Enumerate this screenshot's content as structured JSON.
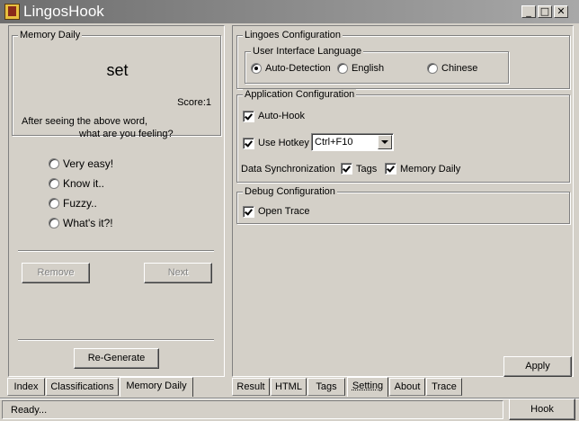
{
  "window": {
    "title": "LingosHook",
    "controls": {
      "minimize": "_",
      "maximize": "□",
      "close": "✕"
    }
  },
  "left": {
    "group_title": "Memory Daily",
    "word": "set",
    "score": "Score:1",
    "question_line1": "After seeing the above word,",
    "question_line2": "what are you feeling?",
    "options": [
      "Very easy!",
      "Know it..",
      "Fuzzy..",
      "What's it?!"
    ],
    "remove_label": "Remove",
    "next_label": "Next",
    "regenerate_label": "Re-Generate",
    "tabs": [
      "Index",
      "Classifications",
      "Memory Daily"
    ],
    "active_tab": "Memory Daily"
  },
  "right": {
    "config_title": "Lingoes Configuration",
    "ui_lang_title": "User Interface Language",
    "lang_options": [
      "Auto-Detection",
      "English",
      "Chinese"
    ],
    "lang_selected": "Auto-Detection",
    "app_config_title": "Application Configuration",
    "auto_hook_label": "Auto-Hook",
    "auto_hook_checked": true,
    "use_hotkey_label": "Use Hotkey",
    "use_hotkey_checked": true,
    "hotkey_value": "Ctrl+F10",
    "data_sync_label": "Data Synchronization",
    "tags_label": "Tags",
    "tags_checked": true,
    "memory_daily_label": "Memory Daily",
    "memory_daily_checked": true,
    "debug_title": "Debug Configuration",
    "open_trace_label": "Open Trace",
    "open_trace_checked": true,
    "apply_label": "Apply",
    "tabs": [
      "Result",
      "HTML",
      "Tags",
      "Setting",
      "About",
      "Trace"
    ],
    "active_tab": "Setting"
  },
  "status": {
    "text": "Ready...",
    "hook_label": "Hook"
  }
}
